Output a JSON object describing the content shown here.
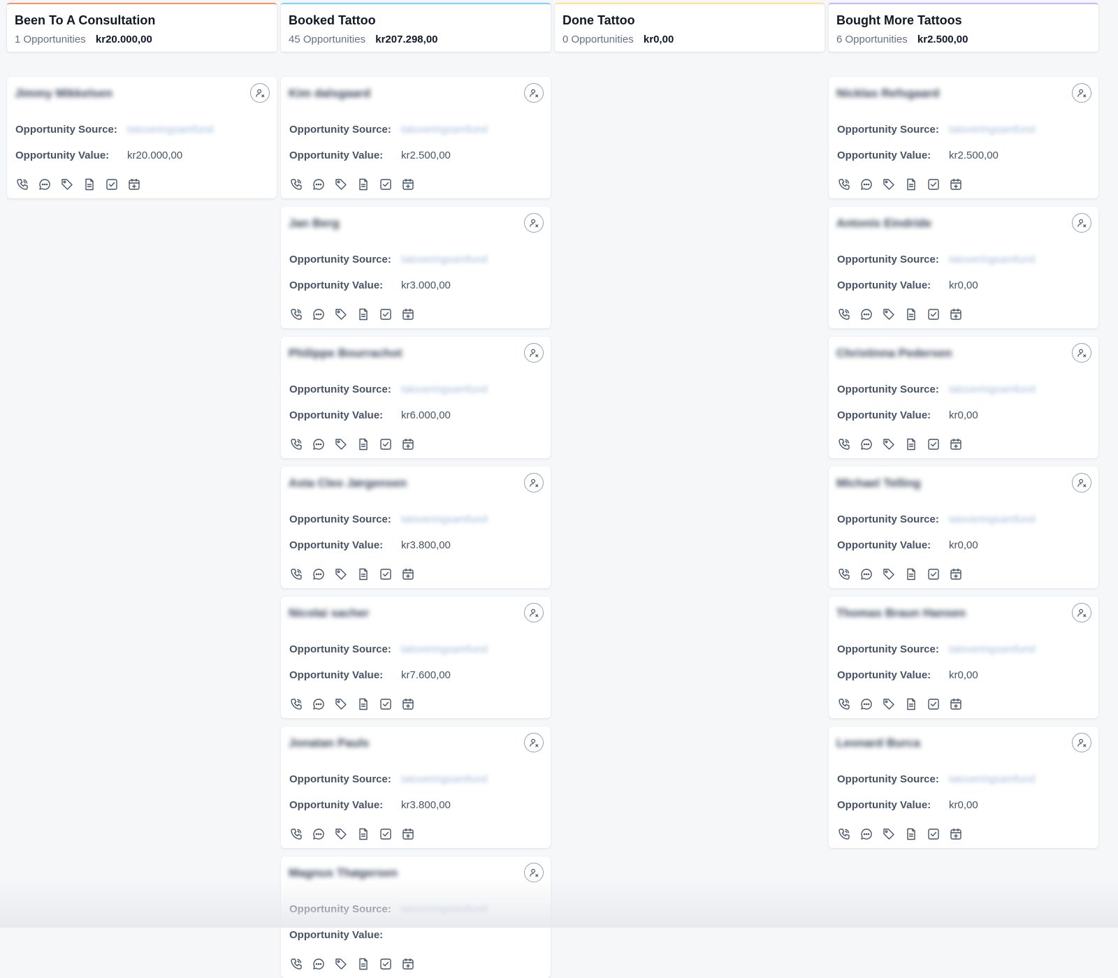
{
  "columns": [
    {
      "title": "Been To A Consultation",
      "count_label": "1 Opportunities",
      "total": "kr20.000,00",
      "accent": "#f79466",
      "cards": [
        {
          "name": "Jimmy Mikkelsen",
          "source_label": "Opportunity Source:",
          "source": "tatoveringsamfund",
          "value_label": "Opportunity Value:",
          "value": "kr20.000,00"
        }
      ]
    },
    {
      "title": "Booked Tattoo",
      "count_label": "45 Opportunities",
      "total": "kr207.298,00",
      "accent": "#7dd3fc",
      "cards": [
        {
          "name": "Kim dalsgaard",
          "source_label": "Opportunity Source:",
          "source": "tatoveringsamfund",
          "value_label": "Opportunity Value:",
          "value": "kr2.500,00"
        },
        {
          "name": "Jan Berg",
          "source_label": "Opportunity Source:",
          "source": "tatoveringsamfund",
          "value_label": "Opportunity Value:",
          "value": "kr3.000,00"
        },
        {
          "name": "Philippe Bourrachot",
          "source_label": "Opportunity Source:",
          "source": "tatoveringsamfund",
          "value_label": "Opportunity Value:",
          "value": "kr6.000,00"
        },
        {
          "name": "Asta Cleo Jørgensen",
          "source_label": "Opportunity Source:",
          "source": "tatoveringsamfund",
          "value_label": "Opportunity Value:",
          "value": "kr3.800,00"
        },
        {
          "name": "Nicolai sacher",
          "source_label": "Opportunity Source:",
          "source": "tatoveringsamfund",
          "value_label": "Opportunity Value:",
          "value": "kr7.600,00"
        },
        {
          "name": "Jonatan Pauls",
          "source_label": "Opportunity Source:",
          "source": "tatoveringsamfund",
          "value_label": "Opportunity Value:",
          "value": "kr3.800,00"
        },
        {
          "name": "Magnus Thøgersen",
          "source_label": "Opportunity Source:",
          "source": "tatoveringsamfund",
          "value_label": "Opportunity Value:",
          "value": ""
        }
      ]
    },
    {
      "title": "Done Tattoo",
      "count_label": "0 Opportunities",
      "total": "kr0,00",
      "accent": "#fde68a",
      "cards": []
    },
    {
      "title": "Bought More Tattoos",
      "count_label": "6 Opportunities",
      "total": "kr2.500,00",
      "accent": "#c4b5fd",
      "cards": [
        {
          "name": "Nicklas Refsgaard",
          "source_label": "Opportunity Source:",
          "source": "tatoveringsamfund",
          "value_label": "Opportunity Value:",
          "value": "kr2.500,00"
        },
        {
          "name": "Antonis Eindride",
          "source_label": "Opportunity Source:",
          "source": "tatoveringsamfund",
          "value_label": "Opportunity Value:",
          "value": "kr0,00"
        },
        {
          "name": "Christinna Pedersen",
          "source_label": "Opportunity Source:",
          "source": "tatoveringsamfund",
          "value_label": "Opportunity Value:",
          "value": "kr0,00"
        },
        {
          "name": "Michael Telling",
          "source_label": "Opportunity Source:",
          "source": "tatoveringsamfund",
          "value_label": "Opportunity Value:",
          "value": "kr0,00"
        },
        {
          "name": "Thomas Braun Hansen",
          "source_label": "Opportunity Source:",
          "source": "tatoveringsamfund",
          "value_label": "Opportunity Value:",
          "value": "kr0,00"
        },
        {
          "name": "Leonard Burca",
          "source_label": "Opportunity Source:",
          "source": "tatoveringsamfund",
          "value_label": "Opportunity Value:",
          "value": "kr0,00"
        }
      ]
    }
  ],
  "card_actions": [
    "phone-icon",
    "chat-icon",
    "tag-icon",
    "note-icon",
    "task-icon",
    "calendar-add-icon"
  ],
  "colors": {
    "icon": "#475467",
    "text_muted": "#667085",
    "card_bg": "#ffffff",
    "board_bg": "#f6f7f9"
  }
}
